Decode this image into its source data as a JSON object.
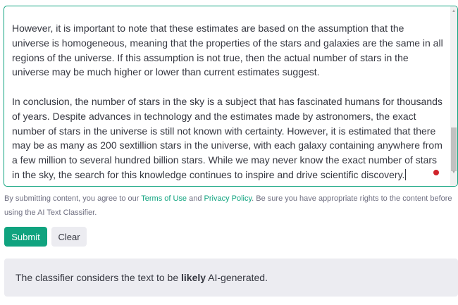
{
  "editor": {
    "paragraph_1": "However, it is important to note that these estimates are based on the assumption that the universe is homogeneous, meaning that the properties of the stars and galaxies are the same in all regions of the universe. If this assumption is not true, then the actual number of stars in the universe may be much higher or lower than current estimates suggest.",
    "paragraph_2": "In conclusion, the number of stars in the sky is a subject that has fascinated humans for thousands of years. Despite advances in technology and the estimates made by astronomers, the exact number of stars in the universe is still not known with certainty. However, it is estimated that there may be as many as 200 sextillion stars in the universe, with each galaxy containing anywhere from a few million to several hundred billion stars. While we may never know the exact number of stars in the sky, the search for this knowledge continues to inspire and drive scientific discovery."
  },
  "disclaimer": {
    "prefix": "By submitting content, you agree to our ",
    "terms_link": "Terms of Use",
    "middle": " and ",
    "privacy_link": "Privacy Policy",
    "suffix": ". Be sure you have appropriate rights to the content before using the AI Text Classifier."
  },
  "buttons": {
    "submit": "Submit",
    "clear": "Clear"
  },
  "result": {
    "prefix": "The classifier considers the text to be ",
    "emphasis": "likely",
    "suffix": " AI-generated."
  },
  "colors": {
    "accent": "#10a37f",
    "indicator_dot": "#d0232b"
  }
}
